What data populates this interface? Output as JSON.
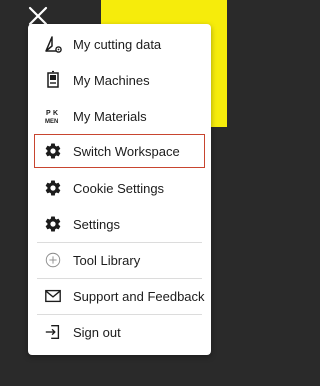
{
  "colors": {
    "background": "#2a2a2a",
    "yellow": "#f6ec0b",
    "menu_bg": "#ffffff",
    "selected_border": "#c8452f",
    "text": "#1c1c1c"
  },
  "close": {
    "icon": "close-icon"
  },
  "menu": {
    "items": [
      {
        "label": "My cutting data",
        "icon": "cutting-data-icon"
      },
      {
        "label": "My Machines",
        "icon": "machine-icon"
      },
      {
        "label": "My Materials",
        "icon": "materials-icon",
        "icon_text": "PK MEN"
      },
      {
        "label": "Switch Workspace",
        "icon": "gear-icon",
        "selected": true
      },
      {
        "label": "Cookie Settings",
        "icon": "gear-icon"
      },
      {
        "label": "Settings",
        "icon": "gear-icon"
      },
      {
        "label": "Tool Library",
        "icon": "tool-library-icon"
      },
      {
        "label": "Support and Feedback",
        "icon": "mail-icon"
      },
      {
        "label": "Sign out",
        "icon": "sign-out-icon"
      }
    ]
  }
}
